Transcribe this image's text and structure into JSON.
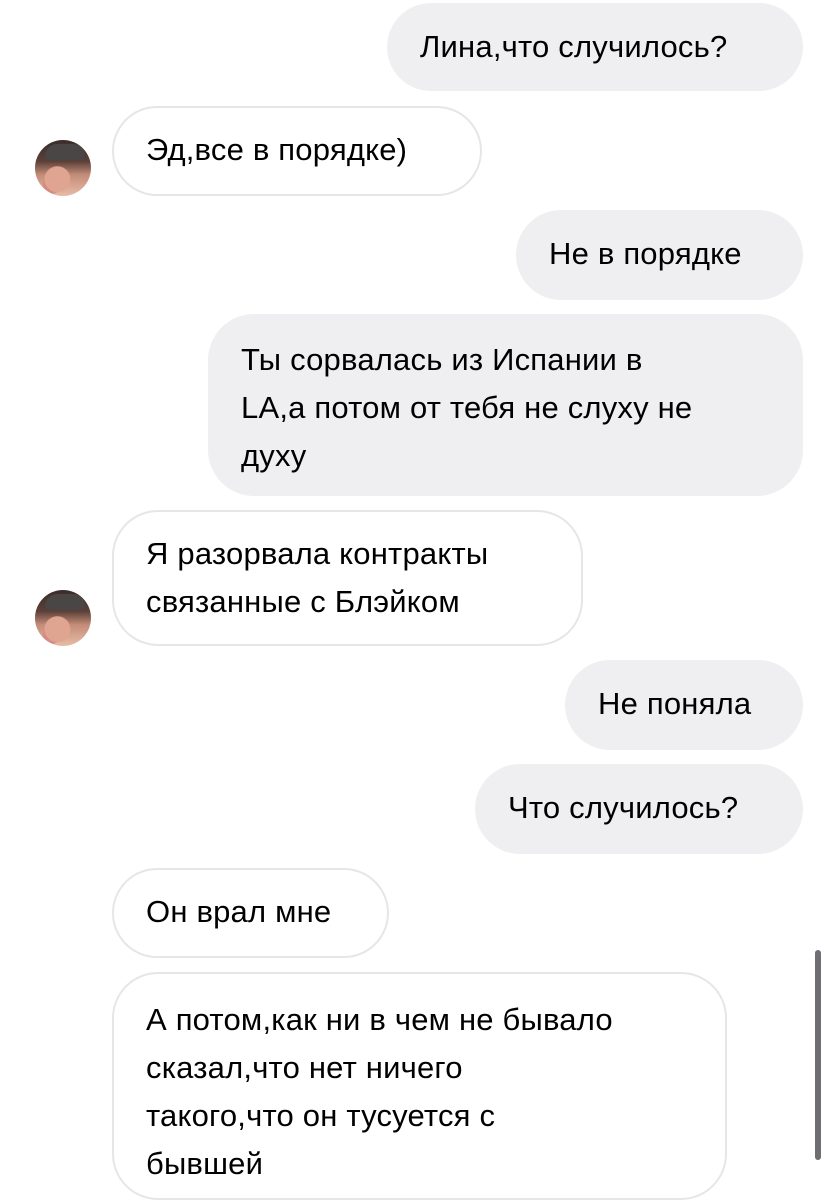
{
  "conversation": {
    "messages": [
      {
        "direction": "outgoing",
        "text": "Лина,что случилось?"
      },
      {
        "direction": "incoming",
        "text": "Эд,все в порядке)"
      },
      {
        "direction": "outgoing",
        "text": "Не в порядке"
      },
      {
        "direction": "outgoing",
        "lines": [
          "Ты сорвалась из Испании в",
          "LA,а потом от тебя не слуху не",
          "духу"
        ]
      },
      {
        "direction": "incoming",
        "lines": [
          "Я разорвала контракты",
          "связанные с Блэйком"
        ]
      },
      {
        "direction": "outgoing",
        "text": "Не поняла"
      },
      {
        "direction": "outgoing",
        "text": "Что случилось?"
      },
      {
        "direction": "incoming",
        "text": "Он врал мне"
      },
      {
        "direction": "incoming",
        "lines": [
          "А потом,как ни в чем не бывало",
          "сказал,что нет ничего",
          "такого,что он тусуется с",
          "бывшей"
        ]
      }
    ]
  },
  "colors": {
    "outgoing_bubble": "#efeff1",
    "incoming_border": "#e6e6e8",
    "text": "#000000",
    "background": "#ffffff"
  }
}
